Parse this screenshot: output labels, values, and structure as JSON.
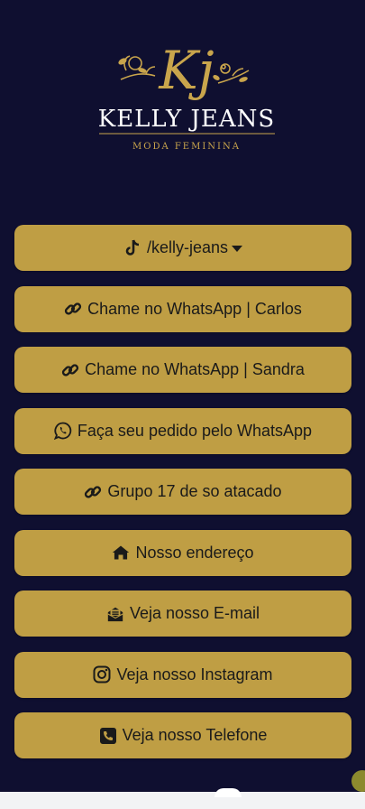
{
  "brand": {
    "name": "KELLY JEANS",
    "tagline": "MODA FEMININA",
    "monogram": "Kj"
  },
  "colors": {
    "background": "#0f0f30",
    "button": "#bf9e44",
    "button_text": "#1a1a1a",
    "logo_gold": "#c9a54c"
  },
  "links": [
    {
      "label": "/kelly-jeans",
      "icon": "tiktok-icon",
      "caret": true
    },
    {
      "label": "Chame no WhatsApp | Carlos",
      "icon": "link-icon"
    },
    {
      "label": "Chame no WhatsApp | Sandra",
      "icon": "link-icon"
    },
    {
      "label": "Faça seu pedido pelo WhatsApp",
      "icon": "whatsapp-icon"
    },
    {
      "label": "Grupo 17 de so atacado",
      "icon": "link-icon"
    },
    {
      "label": "Nosso endereço",
      "icon": "home-icon"
    },
    {
      "label": "Veja nosso E-mail",
      "icon": "envelope-open-icon"
    },
    {
      "label": "Veja nosso Instagram",
      "icon": "instagram-icon"
    },
    {
      "label": "Veja nosso Telefone",
      "icon": "phone-square-icon"
    }
  ]
}
